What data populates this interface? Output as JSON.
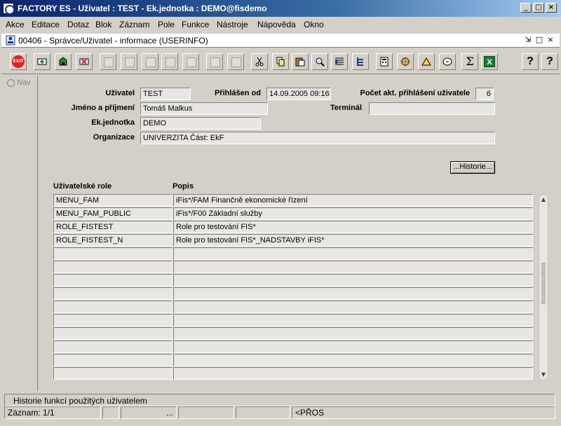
{
  "window": {
    "title": "FACTORY ES - Uživatel : TEST - Ek.jednotka : DEMO@fisdemo",
    "controls": {
      "minimize": "_",
      "maximize": "□",
      "close": "×"
    }
  },
  "menu": [
    "Akce",
    "Editace",
    "Dotaz",
    "Blok",
    "Záznam",
    "Pole",
    "Funkce",
    "Nástroje",
    "Nápověda",
    "Okno"
  ],
  "form": {
    "title": "00406 - Správce/Uživatel - informace (USERINFO)",
    "controls": {
      "restore": "⇲",
      "maximize": "□",
      "close": "×"
    }
  },
  "toolbar": {
    "exit_label": "EXIT",
    "sum_label": "Σ",
    "excel_label": "X",
    "help_label": "?",
    "help2_label": "?"
  },
  "nav": {
    "label": "Nav"
  },
  "user_info": {
    "user_label": "Uživatel",
    "user_value": "TEST",
    "login_label": "Přihlášen od",
    "login_value": "14.09.2005 09:16:",
    "count_label": "Počet akt. přihlášení uživatele",
    "count_value": "6",
    "name_label": "Jméno a příjmení",
    "name_value": "Tomáš Malkus",
    "terminal_label": "Terminál",
    "terminal_value": "",
    "unit_label": "Ek.jednotka",
    "unit_value": "DEMO",
    "org_label": "Organizace",
    "org_value": "UNIVERZITA Část: EkF"
  },
  "history_button": "...Historie...",
  "roles": {
    "col_role": "Uživatelské role",
    "col_desc": "Popis",
    "rows": [
      {
        "role": "MENU_FAM",
        "desc": "iFis*/FAM Finančně ekonomické řízení"
      },
      {
        "role": "MENU_FAM_PUBLIC",
        "desc": "iFis*/F00 Základní služby"
      },
      {
        "role": "ROLE_FISTEST",
        "desc": "Role pro testování FIS*"
      },
      {
        "role": "ROLE_FISTEST_N",
        "desc": "Role pro testování FIS*_NADSTAVBY iFIS*"
      },
      {
        "role": "",
        "desc": ""
      },
      {
        "role": "",
        "desc": ""
      },
      {
        "role": "",
        "desc": ""
      },
      {
        "role": "",
        "desc": ""
      },
      {
        "role": "",
        "desc": ""
      },
      {
        "role": "",
        "desc": ""
      },
      {
        "role": "",
        "desc": ""
      },
      {
        "role": "",
        "desc": ""
      },
      {
        "role": "",
        "desc": ""
      },
      {
        "role": "",
        "desc": ""
      }
    ]
  },
  "status": {
    "hint": "Historie funkcí použitých uživatelem",
    "record": "Záznam: 1/1",
    "dots": "...",
    "mode": "<PŘOS"
  }
}
